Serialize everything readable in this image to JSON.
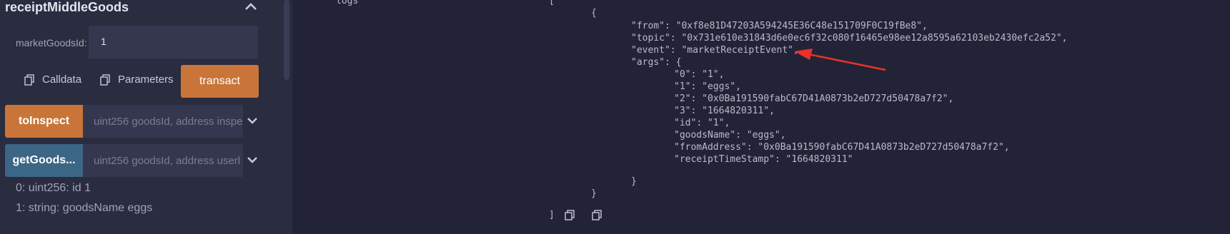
{
  "function": {
    "name": "receiptMiddleGoods",
    "param_label": "marketGoodsId:",
    "param_value": "1",
    "calldata_label": "Calldata",
    "parameters_label": "Parameters",
    "transact_label": "transact"
  },
  "functions": [
    {
      "label": "toInspect",
      "args_placeholder": "uint256 goodsId, address inspe",
      "color": "#c97539"
    },
    {
      "label": "getGoods...",
      "args_placeholder": "uint256 goodsId, address userl",
      "color": "#3c6685"
    }
  ],
  "results": [
    "0: uint256: id 1",
    "1: string: goodsName eggs"
  ],
  "logs": {
    "label": "logs",
    "open_bracket": "[",
    "open_brace": "{",
    "from_key": "\"from\"",
    "from_val": "\"0xf8e81D47203A594245E36C48e151709F0C19fBe8\"",
    "topic_key": "\"topic\"",
    "topic_val": "\"0x731e610e31843d6e0ec6f32c080f16465e98ee12a8595a62103eb2430efc2a52\"",
    "event_key": "\"event\"",
    "event_val": "\"marketReceiptEvent\"",
    "args_key": "\"args\"",
    "args": [
      {
        "k": "\"0\"",
        "v": "\"1\""
      },
      {
        "k": "\"1\"",
        "v": "\"eggs\""
      },
      {
        "k": "\"2\"",
        "v": "\"0x0Ba191590fabC67D41A0873b2eD727d50478a7f2\""
      },
      {
        "k": "\"3\"",
        "v": "\"1664820311\""
      },
      {
        "k": "\"id\"",
        "v": "\"1\""
      },
      {
        "k": "\"goodsName\"",
        "v": "\"eggs\""
      },
      {
        "k": "\"fromAddress\"",
        "v": "\"0x0Ba191590fabC67D41A0873b2eD727d50478a7f2\""
      },
      {
        "k": "\"receiptTimeStamp\"",
        "v": "\"1664820311\""
      }
    ],
    "close_brace": "}",
    "close_bracket": "]"
  },
  "annotation_color": "#e8322b"
}
